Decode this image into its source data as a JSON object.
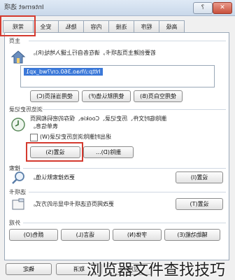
{
  "window": {
    "title": "Internet 选项",
    "help_label": "?",
    "close_label": "✕"
  },
  "tabs": [
    {
      "label": "常规"
    },
    {
      "label": "安全"
    },
    {
      "label": "隐私"
    },
    {
      "label": "内容"
    },
    {
      "label": "连接"
    },
    {
      "label": "程序"
    },
    {
      "label": "高级"
    }
  ],
  "home": {
    "group_label": "主页",
    "instruction": "若要创建主页选项卡，请在各自行上键入地址(R)。",
    "url": "http://hao.360.cn/?wd_xp1",
    "buttons": [
      "使用当前页(C)",
      "使用默认值(F)",
      "使用空白页(B)"
    ]
  },
  "history": {
    "group_label": "浏览历史记录",
    "description_line1": "删除临时文件、历史记录、Cookie、保存的密码和网页",
    "description_line2": "表单信息。",
    "checkbox_label": "退出时删除浏览历史记录(W)",
    "delete_button": "删除(D)...",
    "settings_button": "设置(S)"
  },
  "search": {
    "group_label": "搜索",
    "description": "更改搜索默认值。",
    "settings_button": "设置(I)"
  },
  "tabs_section": {
    "group_label": "选项卡",
    "description": "更改网页在选项卡中显示的方式。",
    "settings_button": "设置(T)"
  },
  "appearance": {
    "group_label": "外观",
    "buttons": [
      "颜色(O)",
      "语言(L)",
      "字体(N)",
      "辅助功能(E)"
    ]
  },
  "footer": {
    "buttons": [
      "确定",
      "取消",
      "应用(A)"
    ]
  },
  "watermark": "浏览器文件查找技巧",
  "icons": [
    "home-icon",
    "history-clock-icon",
    "magnifier-icon",
    "tabs-icon"
  ],
  "colors": {
    "highlight": "#d43a2f",
    "selection": "#3b78d8"
  }
}
